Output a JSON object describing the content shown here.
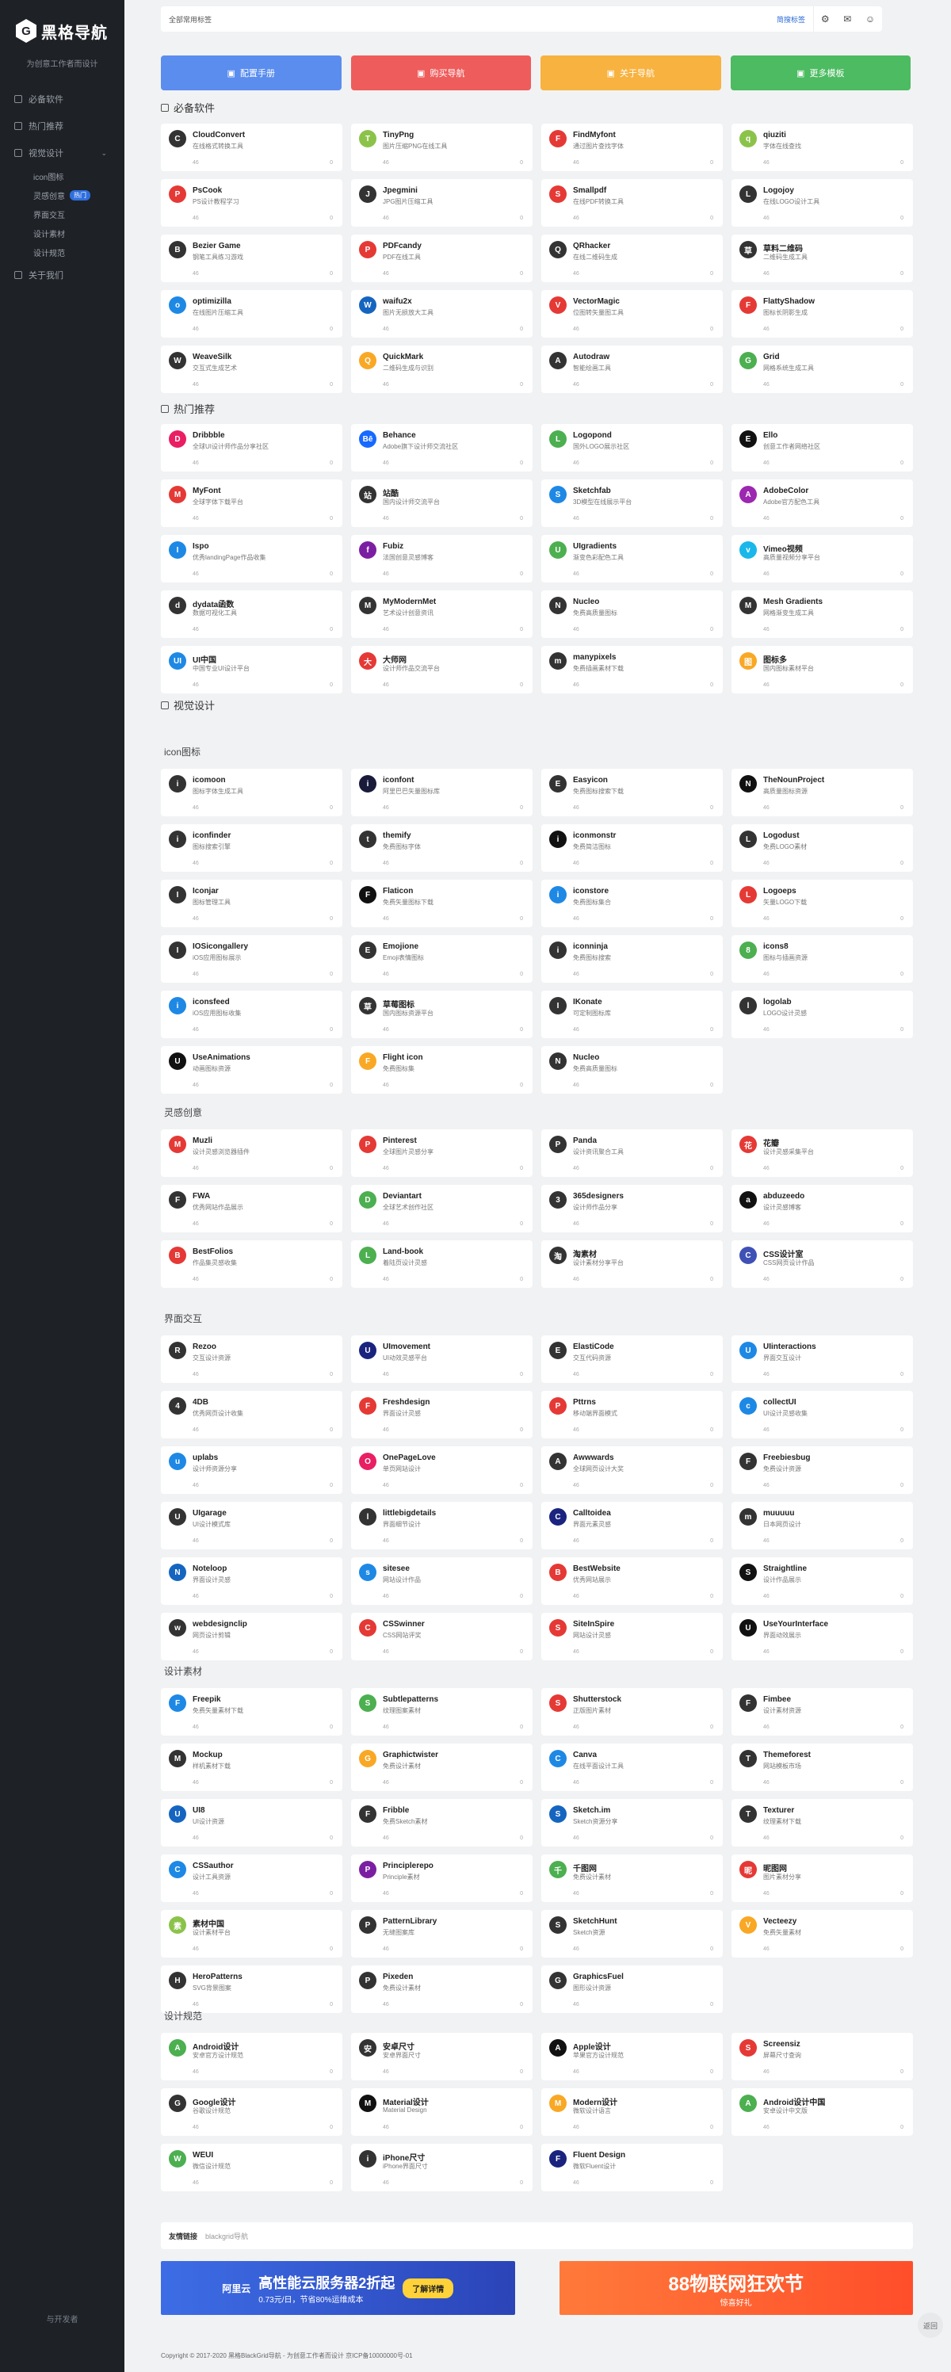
{
  "sidebar": {
    "logo_mark": "G",
    "brand": "黑格导航",
    "tagline": "为创意工作者而设计",
    "items": [
      {
        "label": "必备软件",
        "icon": "box-icon"
      },
      {
        "label": "热门推荐",
        "icon": "fire-icon"
      },
      {
        "label": "视觉设计",
        "icon": "eye-icon",
        "expanded": true
      }
    ],
    "subitems": [
      {
        "label": "icon图标"
      },
      {
        "label": "灵感创意",
        "badge": "热门"
      },
      {
        "label": "界面交互"
      },
      {
        "label": "设计素材"
      },
      {
        "label": "设计规范"
      }
    ],
    "extra": {
      "label": "关于我们",
      "icon": "info-icon"
    },
    "footer": "与开发者"
  },
  "topbar": {
    "search_placeholder": "全部常用标签",
    "search_button": "简搜标签",
    "icons": [
      "gear-icon",
      "chat-icon",
      "user-icon"
    ]
  },
  "banners": [
    {
      "label": "配置手册",
      "color": "#5b8def",
      "icon": "book-icon"
    },
    {
      "label": "购买导航",
      "color": "#ef5c5c",
      "icon": "bag-icon"
    },
    {
      "label": "关于导航",
      "color": "#f8b240",
      "icon": "tag-icon"
    },
    {
      "label": "更多模板",
      "color": "#4cbb61",
      "icon": "grid-icon"
    }
  ],
  "sections": [
    {
      "title": "必备软件",
      "level": "sec",
      "items": [
        {
          "name": "CloudConvert",
          "desc": "在线格式转换工具",
          "color": "#333",
          "init": "C"
        },
        {
          "name": "TinyPng",
          "desc": "图片压缩PNG在线工具",
          "color": "#8bc34a",
          "init": "T"
        },
        {
          "name": "FindMyfont",
          "desc": "通过图片查找字体",
          "color": "#e53935",
          "init": "F"
        },
        {
          "name": "qiuziti",
          "desc": "字体在线查找",
          "color": "#8bc34a",
          "init": "q"
        },
        {
          "name": "PsCook",
          "desc": "PS设计教程学习",
          "color": "#e53935",
          "init": "P"
        },
        {
          "name": "Jpegmini",
          "desc": "JPG图片压缩工具",
          "color": "#333",
          "init": "J"
        },
        {
          "name": "Smallpdf",
          "desc": "在线PDF转换工具",
          "color": "#e53935",
          "init": "S"
        },
        {
          "name": "Logojoy",
          "desc": "在线LOGO设计工具",
          "color": "#333",
          "init": "L"
        },
        {
          "name": "Bezier Game",
          "desc": "钢笔工具练习游戏",
          "color": "#333",
          "init": "B"
        },
        {
          "name": "PDFcandy",
          "desc": "PDF在线工具",
          "color": "#e53935",
          "init": "P"
        },
        {
          "name": "QRhacker",
          "desc": "在线二维码生成",
          "color": "#333",
          "init": "Q"
        },
        {
          "name": "草料二维码",
          "desc": "二维码生成工具",
          "color": "#333",
          "init": "草"
        },
        {
          "name": "optimizilla",
          "desc": "在线图片压缩工具",
          "color": "#1e88e5",
          "init": "o"
        },
        {
          "name": "waifu2x",
          "desc": "图片无损放大工具",
          "color": "#1565c0",
          "init": "W"
        },
        {
          "name": "VectorMagic",
          "desc": "位图转矢量图工具",
          "color": "#e53935",
          "init": "V"
        },
        {
          "name": "FlattyShadow",
          "desc": "图标长阴影生成",
          "color": "#e53935",
          "init": "F"
        },
        {
          "name": "WeaveSilk",
          "desc": "交互式生成艺术",
          "color": "#333",
          "init": "W"
        },
        {
          "name": "QuickMark",
          "desc": "二维码生成与识别",
          "color": "#f9a825",
          "init": "Q"
        },
        {
          "name": "Autodraw",
          "desc": "智能绘画工具",
          "color": "#333",
          "init": "A"
        },
        {
          "name": "Grid",
          "desc": "网格系统生成工具",
          "color": "#4caf50",
          "init": "G"
        }
      ]
    },
    {
      "title": "热门推荐",
      "level": "sec",
      "items": [
        {
          "name": "Dribbble",
          "desc": "全球UI设计师作品分享社区",
          "color": "#e91e63",
          "init": "D"
        },
        {
          "name": "Behance",
          "desc": "Adobe旗下设计师交流社区",
          "color": "#1769ff",
          "init": "Bē"
        },
        {
          "name": "Logopond",
          "desc": "国外LOGO展示社区",
          "color": "#4caf50",
          "init": "L"
        },
        {
          "name": "Ello",
          "desc": "创意工作者网络社区",
          "color": "#111",
          "init": "E"
        },
        {
          "name": "MyFont",
          "desc": "全球字体下载平台",
          "color": "#e53935",
          "init": "M"
        },
        {
          "name": "站酷",
          "desc": "国内设计师交流平台",
          "color": "#333",
          "init": "站"
        },
        {
          "name": "Sketchfab",
          "desc": "3D模型在线展示平台",
          "color": "#1e88e5",
          "init": "S"
        },
        {
          "name": "AdobeColor",
          "desc": "Adobe官方配色工具",
          "color": "#9c27b0",
          "init": "A"
        },
        {
          "name": "Ispo",
          "desc": "优秀landingPage作品收集",
          "color": "#1e88e5",
          "init": "I"
        },
        {
          "name": "Fubiz",
          "desc": "法国创意灵感博客",
          "color": "#7b1fa2",
          "init": "f"
        },
        {
          "name": "UIgradients",
          "desc": "渐变色彩配色工具",
          "color": "#4caf50",
          "init": "U"
        },
        {
          "name": "Vimeo视频",
          "desc": "高质量视频分享平台",
          "color": "#1ab7ea",
          "init": "v"
        },
        {
          "name": "dydata函数",
          "desc": "数据可视化工具",
          "color": "#333",
          "init": "d"
        },
        {
          "name": "MyModernMet",
          "desc": "艺术设计创意资讯",
          "color": "#333",
          "init": "M"
        },
        {
          "name": "Nucleo",
          "desc": "免费高质量图标",
          "color": "#333",
          "init": "N"
        },
        {
          "name": "Mesh Gradients",
          "desc": "网格渐变生成工具",
          "color": "#333",
          "init": "M"
        },
        {
          "name": "UI中国",
          "desc": "中国专业UI设计平台",
          "color": "#1e88e5",
          "init": "UI"
        },
        {
          "name": "大师网",
          "desc": "设计师作品交流平台",
          "color": "#e53935",
          "init": "大"
        },
        {
          "name": "manypixels",
          "desc": "免费插画素材下载",
          "color": "#333",
          "init": "m"
        },
        {
          "name": "图标多",
          "desc": "国内图标素材平台",
          "color": "#f9a825",
          "init": "图"
        }
      ]
    },
    {
      "title": "视觉设计",
      "level": "sec",
      "items": []
    },
    {
      "title": "icon图标",
      "level": "sub",
      "items": [
        {
          "name": "icomoon",
          "desc": "图标字体生成工具",
          "color": "#333",
          "init": "i"
        },
        {
          "name": "iconfont",
          "desc": "阿里巴巴矢量图标库",
          "color": "#1a1a3a",
          "init": "i"
        },
        {
          "name": "Easyicon",
          "desc": "免费图标搜索下载",
          "color": "#333",
          "init": "E"
        },
        {
          "name": "TheNounProject",
          "desc": "高质量图标资源",
          "color": "#111",
          "init": "N"
        },
        {
          "name": "iconfinder",
          "desc": "图标搜索引擎",
          "color": "#333",
          "init": "i"
        },
        {
          "name": "themify",
          "desc": "免费图标字体",
          "color": "#333",
          "init": "t"
        },
        {
          "name": "iconmonstr",
          "desc": "免费简洁图标",
          "color": "#111",
          "init": "i"
        },
        {
          "name": "Logodust",
          "desc": "免费LOGO素材",
          "color": "#333",
          "init": "L"
        },
        {
          "name": "Iconjar",
          "desc": "图标管理工具",
          "color": "#333",
          "init": "I"
        },
        {
          "name": "Flaticon",
          "desc": "免费矢量图标下载",
          "color": "#111",
          "init": "F"
        },
        {
          "name": "iconstore",
          "desc": "免费图标集合",
          "color": "#1e88e5",
          "init": "i"
        },
        {
          "name": "Logoeps",
          "desc": "矢量LOGO下载",
          "color": "#e53935",
          "init": "L"
        },
        {
          "name": "IOSicongallery",
          "desc": "iOS应用图标展示",
          "color": "#333",
          "init": "I"
        },
        {
          "name": "Emojione",
          "desc": "Emoji表情图标",
          "color": "#333",
          "init": "E"
        },
        {
          "name": "iconninja",
          "desc": "免费图标搜索",
          "color": "#333",
          "init": "i"
        },
        {
          "name": "icons8",
          "desc": "图标与插画资源",
          "color": "#4caf50",
          "init": "8"
        },
        {
          "name": "iconsfeed",
          "desc": "iOS应用图标收集",
          "color": "#1e88e5",
          "init": "i"
        },
        {
          "name": "草莓图标",
          "desc": "国内图标资源平台",
          "color": "#333",
          "init": "草"
        },
        {
          "name": "IKonate",
          "desc": "可定制图标库",
          "color": "#333",
          "init": "I"
        },
        {
          "name": "logolab",
          "desc": "LOGO设计灵感",
          "color": "#333",
          "init": "l"
        },
        {
          "name": "UseAnimations",
          "desc": "动画图标资源",
          "color": "#111",
          "init": "U"
        },
        {
          "name": "Flight icon",
          "desc": "免费图标集",
          "color": "#f9a825",
          "init": "F"
        },
        {
          "name": "Nucleo",
          "desc": "免费高质量图标",
          "color": "#333",
          "init": "N"
        }
      ]
    },
    {
      "title": "灵感创意",
      "level": "sub",
      "items": [
        {
          "name": "Muzli",
          "desc": "设计灵感浏览器插件",
          "color": "#e53935",
          "init": "M"
        },
        {
          "name": "Pinterest",
          "desc": "全球图片灵感分享",
          "color": "#e53935",
          "init": "P"
        },
        {
          "name": "Panda",
          "desc": "设计资讯聚合工具",
          "color": "#333",
          "init": "P"
        },
        {
          "name": "花瓣",
          "desc": "设计灵感采集平台",
          "color": "#e53935",
          "init": "花"
        },
        {
          "name": "FWA",
          "desc": "优秀网站作品展示",
          "color": "#333",
          "init": "F"
        },
        {
          "name": "Deviantart",
          "desc": "全球艺术创作社区",
          "color": "#4caf50",
          "init": "D"
        },
        {
          "name": "365designers",
          "desc": "设计师作品分享",
          "color": "#333",
          "init": "3"
        },
        {
          "name": "abduzeedo",
          "desc": "设计灵感博客",
          "color": "#111",
          "init": "a"
        },
        {
          "name": "BestFolios",
          "desc": "作品集灵感收集",
          "color": "#e53935",
          "init": "B"
        },
        {
          "name": "Land-book",
          "desc": "着陆页设计灵感",
          "color": "#4caf50",
          "init": "L"
        },
        {
          "name": "淘素材",
          "desc": "设计素材分享平台",
          "color": "#333",
          "init": "淘"
        },
        {
          "name": "CSS设计室",
          "desc": "CSS网页设计作品",
          "color": "#3f51b5",
          "init": "C"
        }
      ]
    },
    {
      "title": "界面交互",
      "level": "sub",
      "items": [
        {
          "name": "Rezoo",
          "desc": "交互设计资源",
          "color": "#333",
          "init": "R"
        },
        {
          "name": "UImovement",
          "desc": "UI动效灵感平台",
          "color": "#1a237e",
          "init": "U"
        },
        {
          "name": "ElastiCode",
          "desc": "交互代码资源",
          "color": "#333",
          "init": "E"
        },
        {
          "name": "UIinteractions",
          "desc": "界面交互设计",
          "color": "#1e88e5",
          "init": "U"
        },
        {
          "name": "4DB",
          "desc": "优秀网页设计收集",
          "color": "#333",
          "init": "4"
        },
        {
          "name": "Freshdesign",
          "desc": "界面设计灵感",
          "color": "#e53935",
          "init": "F"
        },
        {
          "name": "Pttrns",
          "desc": "移动端界面模式",
          "color": "#e53935",
          "init": "P"
        },
        {
          "name": "collectUI",
          "desc": "UI设计灵感收集",
          "color": "#1e88e5",
          "init": "c"
        },
        {
          "name": "uplabs",
          "desc": "设计师资源分享",
          "color": "#1e88e5",
          "init": "u"
        },
        {
          "name": "OnePageLove",
          "desc": "单页网站设计",
          "color": "#e91e63",
          "init": "O"
        },
        {
          "name": "Awwwards",
          "desc": "全球网页设计大奖",
          "color": "#333",
          "init": "A"
        },
        {
          "name": "Freebiesbug",
          "desc": "免费设计资源",
          "color": "#333",
          "init": "F"
        },
        {
          "name": "UIgarage",
          "desc": "UI设计模式库",
          "color": "#333",
          "init": "U"
        },
        {
          "name": "littlebigdetails",
          "desc": "界面细节设计",
          "color": "#333",
          "init": "l"
        },
        {
          "name": "Calltoidea",
          "desc": "界面元素灵感",
          "color": "#1a237e",
          "init": "C"
        },
        {
          "name": "muuuuu",
          "desc": "日本网页设计",
          "color": "#333",
          "init": "m"
        },
        {
          "name": "Noteloop",
          "desc": "界面设计灵感",
          "color": "#1565c0",
          "init": "N"
        },
        {
          "name": "sitesee",
          "desc": "网站设计作品",
          "color": "#1e88e5",
          "init": "s"
        },
        {
          "name": "BestWebsite",
          "desc": "优秀网站展示",
          "color": "#e53935",
          "init": "B"
        },
        {
          "name": "Straightline",
          "desc": "设计作品展示",
          "color": "#111",
          "init": "S"
        },
        {
          "name": "webdesignclip",
          "desc": "网页设计剪辑",
          "color": "#333",
          "init": "w"
        },
        {
          "name": "CSSwinner",
          "desc": "CSS网站评奖",
          "color": "#e53935",
          "init": "C"
        },
        {
          "name": "SiteInSpire",
          "desc": "网站设计灵感",
          "color": "#e53935",
          "init": "S"
        },
        {
          "name": "UseYourInterface",
          "desc": "界面动效展示",
          "color": "#111",
          "init": "U"
        }
      ]
    },
    {
      "title": "设计素材",
      "level": "sub",
      "items": [
        {
          "name": "Freepik",
          "desc": "免费矢量素材下载",
          "color": "#1e88e5",
          "init": "F"
        },
        {
          "name": "Subtlepatterns",
          "desc": "纹理图案素材",
          "color": "#4caf50",
          "init": "S"
        },
        {
          "name": "Shutterstock",
          "desc": "正版图片素材",
          "color": "#e53935",
          "init": "S"
        },
        {
          "name": "Fimbee",
          "desc": "设计素材资源",
          "color": "#333",
          "init": "F"
        },
        {
          "name": "Mockup",
          "desc": "样机素材下载",
          "color": "#333",
          "init": "M"
        },
        {
          "name": "Graphictwister",
          "desc": "免费设计素材",
          "color": "#f9a825",
          "init": "G"
        },
        {
          "name": "Canva",
          "desc": "在线平面设计工具",
          "color": "#1e88e5",
          "init": "C"
        },
        {
          "name": "Themeforest",
          "desc": "网站模板市场",
          "color": "#333",
          "init": "T"
        },
        {
          "name": "UI8",
          "desc": "UI设计资源",
          "color": "#1565c0",
          "init": "U"
        },
        {
          "name": "Fribble",
          "desc": "免费Sketch素材",
          "color": "#333",
          "init": "F"
        },
        {
          "name": "Sketch.im",
          "desc": "Sketch资源分享",
          "color": "#1565c0",
          "init": "S"
        },
        {
          "name": "Texturer",
          "desc": "纹理素材下载",
          "color": "#333",
          "init": "T"
        },
        {
          "name": "CSSauthor",
          "desc": "设计工具资源",
          "color": "#1e88e5",
          "init": "C"
        },
        {
          "name": "Principlerepo",
          "desc": "Principle素材",
          "color": "#7b1fa2",
          "init": "P"
        },
        {
          "name": "千图网",
          "desc": "免费设计素材",
          "color": "#4caf50",
          "init": "千"
        },
        {
          "name": "昵图网",
          "desc": "图片素材分享",
          "color": "#e53935",
          "init": "昵"
        },
        {
          "name": "素材中国",
          "desc": "设计素材平台",
          "color": "#8bc34a",
          "init": "素"
        },
        {
          "name": "PatternLibrary",
          "desc": "无缝图案库",
          "color": "#333",
          "init": "P"
        },
        {
          "name": "SketchHunt",
          "desc": "Sketch资源",
          "color": "#333",
          "init": "S"
        },
        {
          "name": "Vecteezy",
          "desc": "免费矢量素材",
          "color": "#f9a825",
          "init": "V"
        },
        {
          "name": "HeroPatterns",
          "desc": "SVG背景图案",
          "color": "#333",
          "init": "H"
        },
        {
          "name": "Pixeden",
          "desc": "免费设计素材",
          "color": "#333",
          "init": "P"
        },
        {
          "name": "GraphicsFuel",
          "desc": "图形设计资源",
          "color": "#333",
          "init": "G"
        }
      ]
    },
    {
      "title": "设计规范",
      "level": "sub",
      "items": [
        {
          "name": "Android设计",
          "desc": "安卓官方设计规范",
          "color": "#4caf50",
          "init": "A"
        },
        {
          "name": "安卓尺寸",
          "desc": "安卓界面尺寸",
          "color": "#333",
          "init": "安"
        },
        {
          "name": "Apple设计",
          "desc": "苹果官方设计规范",
          "color": "#111",
          "init": "A"
        },
        {
          "name": "Screensiz",
          "desc": "屏幕尺寸查询",
          "color": "#e53935",
          "init": "S"
        },
        {
          "name": "Google设计",
          "desc": "谷歌设计规范",
          "color": "#333",
          "init": "G"
        },
        {
          "name": "Material设计",
          "desc": "Material Design",
          "color": "#111",
          "init": "M"
        },
        {
          "name": "Modern设计",
          "desc": "微软设计语言",
          "color": "#f9a825",
          "init": "M"
        },
        {
          "name": "Android设计中国",
          "desc": "安卓设计中文版",
          "color": "#4caf50",
          "init": "A"
        },
        {
          "name": "WEUI",
          "desc": "微信设计规范",
          "color": "#4caf50",
          "init": "W"
        },
        {
          "name": "iPhone尺寸",
          "desc": "iPhone界面尺寸",
          "color": "#333",
          "init": "i"
        },
        {
          "name": "Fluent Design",
          "desc": "微软Fluent设计",
          "color": "#1a237e",
          "init": "F"
        }
      ]
    }
  ],
  "links": {
    "label": "友情链接",
    "item": "blackgrid导航"
  },
  "ads": [
    {
      "title": "高性能云服务器2折起",
      "sub": "0.73元/日，节省80%运维成本",
      "brand": "阿里云",
      "cta": "了解详情"
    },
    {
      "title": "88物联网狂欢节",
      "sub": "惊喜好礼",
      "brand": "",
      "cta": ""
    }
  ],
  "footer": "Copyright © 2017-2020  黑格BlackGrid导航 - 为创意工作者而设计  京ICP备10000000号-01",
  "fab_label": "返回",
  "card_meta": "46",
  "card_likes": "0"
}
